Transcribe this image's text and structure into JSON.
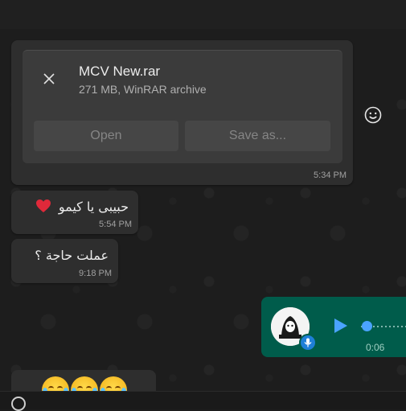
{
  "file_message": {
    "name": "MCV New.rar",
    "meta": "271 MB, WinRAR archive",
    "open_label": "Open",
    "save_label": "Save as...",
    "time": "5:34 PM"
  },
  "messages": [
    {
      "text": "حبيبى يا كيمو",
      "time": "5:54 PM",
      "emoji": "red-heart"
    },
    {
      "text": "عملت حاجة ؟",
      "time": "9:18 PM"
    }
  ],
  "voice_message": {
    "duration": "0:06",
    "progress": 0
  },
  "emoji_message": {
    "emojis": [
      "face-with-tears-of-joy",
      "face-with-tears-of-joy",
      "face-with-tears-of-joy"
    ]
  },
  "colors": {
    "incoming_bubble": "#2e2e2e",
    "outgoing_bubble": "#005c4b",
    "accent_blue": "#4aa3ff"
  },
  "icons": [
    "close-icon",
    "emoji-icon",
    "play-icon",
    "mic-icon",
    "heart-icon"
  ]
}
